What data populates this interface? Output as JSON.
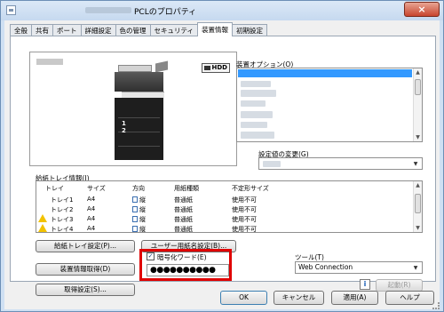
{
  "window": {
    "title": "PCLのプロパティ",
    "close_glyph": "×"
  },
  "tabs": [
    {
      "label": "全般"
    },
    {
      "label": "共有"
    },
    {
      "label": "ポート"
    },
    {
      "label": "詳細設定"
    },
    {
      "label": "色の管理"
    },
    {
      "label": "セキュリティ"
    },
    {
      "label": "装置情報",
      "active": true
    },
    {
      "label": "初期設定"
    }
  ],
  "device_preview": {
    "hdd_label": "HDD",
    "tray_numbers": [
      "1",
      "2"
    ]
  },
  "options": {
    "label": "装置オプション(O)",
    "change_label": "設定値の変更(G)"
  },
  "paper_trays": {
    "label": "給紙トレイ情報(I)",
    "columns": [
      "トレイ",
      "サイズ",
      "方向",
      "用紙種類",
      "不定形サイズ"
    ],
    "rows": [
      {
        "tray": "トレイ1",
        "size": "A4",
        "orientation": "縦",
        "paper_type": "普通紙",
        "custom_size": "使用不可",
        "warning": false
      },
      {
        "tray": "トレイ2",
        "size": "A4",
        "orientation": "縦",
        "paper_type": "普通紙",
        "custom_size": "使用不可",
        "warning": false
      },
      {
        "tray": "トレイ3",
        "size": "A4",
        "orientation": "縦",
        "paper_type": "普通紙",
        "custom_size": "使用不可",
        "warning": true
      },
      {
        "tray": "トレイ4",
        "size": "A4",
        "orientation": "縦",
        "paper_type": "普通紙",
        "custom_size": "使用不可",
        "warning": true
      }
    ]
  },
  "buttons": {
    "tray_settings": "給紙トレイ設定(P)...",
    "user_paper_name": "ユーザー用紙名設定(B)...",
    "get_device_info": "装置情報取得(D)",
    "get_settings": "取得設定(S)...",
    "launch": "起動(R)",
    "ok": "OK",
    "cancel": "キャンセル",
    "apply": "適用(A)",
    "help": "ヘルプ"
  },
  "encryption": {
    "checkbox_label": "暗号化ワード(E)",
    "checked": true,
    "password_mask": "●●●●●●●●●●"
  },
  "tool": {
    "label": "ツール(T)",
    "selected": "Web Connection"
  },
  "icons": {
    "info_icon_glyph": "i",
    "check_glyph": "✓",
    "dropdown_glyph": "▼",
    "scroll_up_glyph": "▲",
    "scroll_down_glyph": "▼"
  }
}
